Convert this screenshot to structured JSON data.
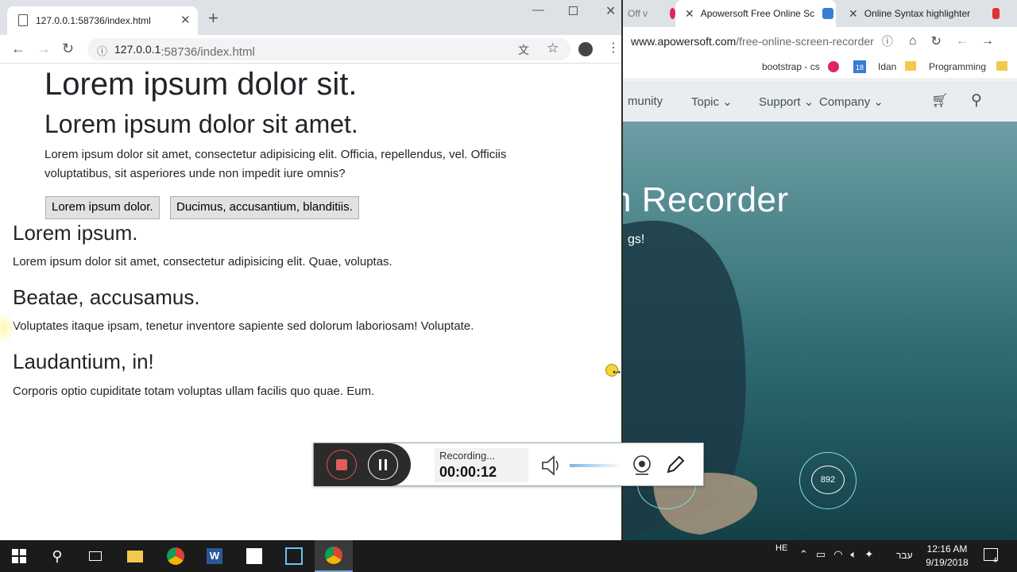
{
  "left_browser": {
    "tab_title": "127.0.0.1:58736/index.html",
    "url_host": "127.0.0.1",
    "url_path": ":58736/index.html"
  },
  "page": {
    "h1": "Lorem ipsum dolor sit.",
    "h2": "Lorem ipsum dolor sit amet.",
    "intro_line1": "Lorem ipsum dolor sit amet, consectetur adipisicing elit. Officia, repellendus, vel. Officiis",
    "intro_line2": "voluptatibus, sit asperiores unde non impedit iure omnis?",
    "button1": "Lorem ipsum dolor.",
    "button2": "Ducimus, accusantium, blanditiis.",
    "sections": [
      {
        "heading": "Lorem ipsum.",
        "text": "Lorem ipsum dolor sit amet, consectetur adipisicing elit. Quae, voluptas."
      },
      {
        "heading": "Beatae, accusamus.",
        "text": "Voluptates itaque ipsam, tenetur inventore sapiente sed dolorum laboriosam! Voluptate."
      },
      {
        "heading": "Laudantium, in!",
        "text": "Corporis optio cupiditate totam voluptas ullam facilis quo quae. Eum."
      }
    ]
  },
  "right_browser": {
    "tab_partial": "Off v",
    "tab_active": "Apowersoft Free Online Sc",
    "tab_other": "Online Syntax highlighter",
    "url_host": "www.apowersoft.com",
    "url_path": "/free-online-screen-recorder",
    "bookmarks": [
      "bootstrap - cs",
      "Idan",
      "Programming"
    ],
    "bookmark_badge": "18",
    "nav": [
      "munity",
      "Topic",
      "Support",
      "Company"
    ],
    "hero_title": "n Recorder",
    "hero_sub": "gs!",
    "bubble_count": "892"
  },
  "recorder": {
    "status": "Recording...",
    "time": "00:00:12"
  },
  "taskbar": {
    "lang_top": "HE",
    "lang_bottom": "עבר",
    "time": "12:16 AM",
    "date": "9/19/2018",
    "notif_count": "4"
  },
  "colors": {
    "stop_red": "#e25c5c",
    "tab_bar": "#dee1e6",
    "taskbar": "#1b1b1b"
  }
}
